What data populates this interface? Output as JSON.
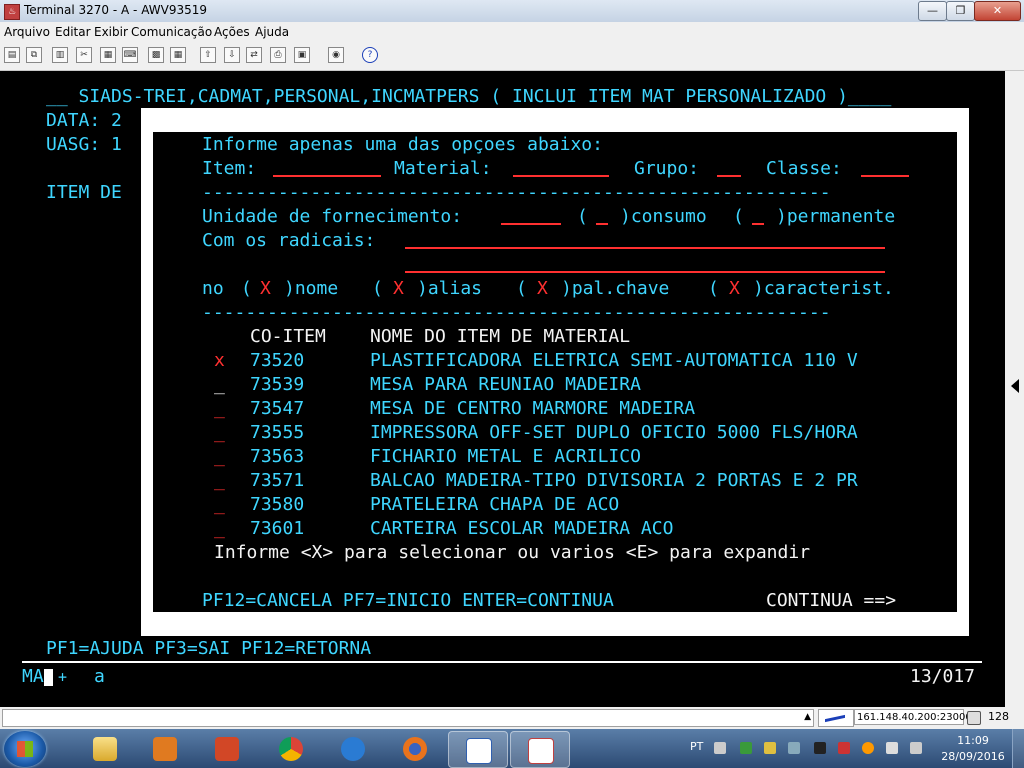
{
  "window": {
    "title": "Terminal 3270 - A - AWV93519",
    "app_icon": "java-icon"
  },
  "menu": [
    "Arquivo",
    "Editar",
    "Exibir",
    "Comunicação",
    "Ações",
    "Ajuda"
  ],
  "toolbar": {
    "icons": [
      "print-screen-icon",
      "copy-icon",
      "paste-icon",
      "cut-icon",
      "select-icon",
      "keyboard-icon",
      "send-file-icon",
      "receive-file-icon",
      "color-icon",
      "settings-icon",
      "macro-icon",
      "help-icon"
    ]
  },
  "screen": {
    "header": "__ SIADS-TREI,CADMAT,PERSONAL,INCMATPERS ( INCLUI ITEM MAT PERSONALIZADO )____",
    "data_label": "DATA: 2",
    "uasg_label": "UASG: 1",
    "item_label": "ITEM DE",
    "footer_keys": "PF1=AJUDA PF3=SAI PF12=RETORNA",
    "oia_left": "MA",
    "oia_plus": "+",
    "oia_a": "a",
    "oia_pos": "13/017"
  },
  "popup": {
    "instruction": "Informe apenas uma das opçoes abaixo:",
    "item_label": "Item:",
    "material_label": "Material:",
    "grupo_label": "Grupo:",
    "classe_label": "Classe:",
    "separator": "----------------------------------------------------------",
    "unidade_label": "Unidade de fornecimento:",
    "consumo_label": ")consumo",
    "permanente_label": ")permanente",
    "radicais_label": "Com os radicais:",
    "no_label": "no",
    "nome_label": ")nome",
    "alias_label": ")alias",
    "palchave_label": ")pal.chave",
    "caract_label": ")caracterist.",
    "check_mark": "X",
    "col_coitem": "CO-ITEM",
    "col_nome": "NOME DO ITEM DE MATERIAL",
    "rows": [
      {
        "sel": "x",
        "code": "73520",
        "name": "PLASTIFICADORA ELETRICA SEMI-AUTOMATICA 110 V"
      },
      {
        "sel": "_",
        "code": "73539",
        "name": "MESA PARA REUNIAO MADEIRA"
      },
      {
        "sel": "_",
        "code": "73547",
        "name": "MESA DE CENTRO MARMORE MADEIRA"
      },
      {
        "sel": "_",
        "code": "73555",
        "name": "IMPRESSORA OFF-SET DUPLO OFICIO 5000 FLS/HORA"
      },
      {
        "sel": "_",
        "code": "73563",
        "name": "FICHARIO METAL E ACRILICO"
      },
      {
        "sel": "_",
        "code": "73571",
        "name": "BALCAO MADEIRA-TIPO DIVISORIA 2 PORTAS E 2 PR"
      },
      {
        "sel": "_",
        "code": "73580",
        "name": "PRATELEIRA CHAPA DE ACO"
      },
      {
        "sel": "_",
        "code": "73601",
        "name": "CARTEIRA ESCOLAR MADEIRA ACO"
      }
    ],
    "hint": "Informe <X> para selecionar ou varios <E> para expandir",
    "pf_keys": "PF12=CANCELA PF7=INICIO ENTER=CONTINUA",
    "continua": "CONTINUA ==>"
  },
  "status": {
    "ip": "161.148.40.200:23000",
    "kb_count": "128"
  },
  "taskbar": {
    "lang": "PT",
    "time": "11:09",
    "date": "28/09/2016",
    "apps": [
      "explorer-icon",
      "media-player-icon",
      "powerpoint-icon",
      "chrome-icon",
      "ie-icon",
      "firefox-icon",
      "wordpad-icon",
      "java-icon"
    ]
  },
  "colors": {
    "terminal_bg": "#000000",
    "cyan": "#3fd6ff",
    "red": "#ff3030",
    "white": "#f4f4f4"
  }
}
